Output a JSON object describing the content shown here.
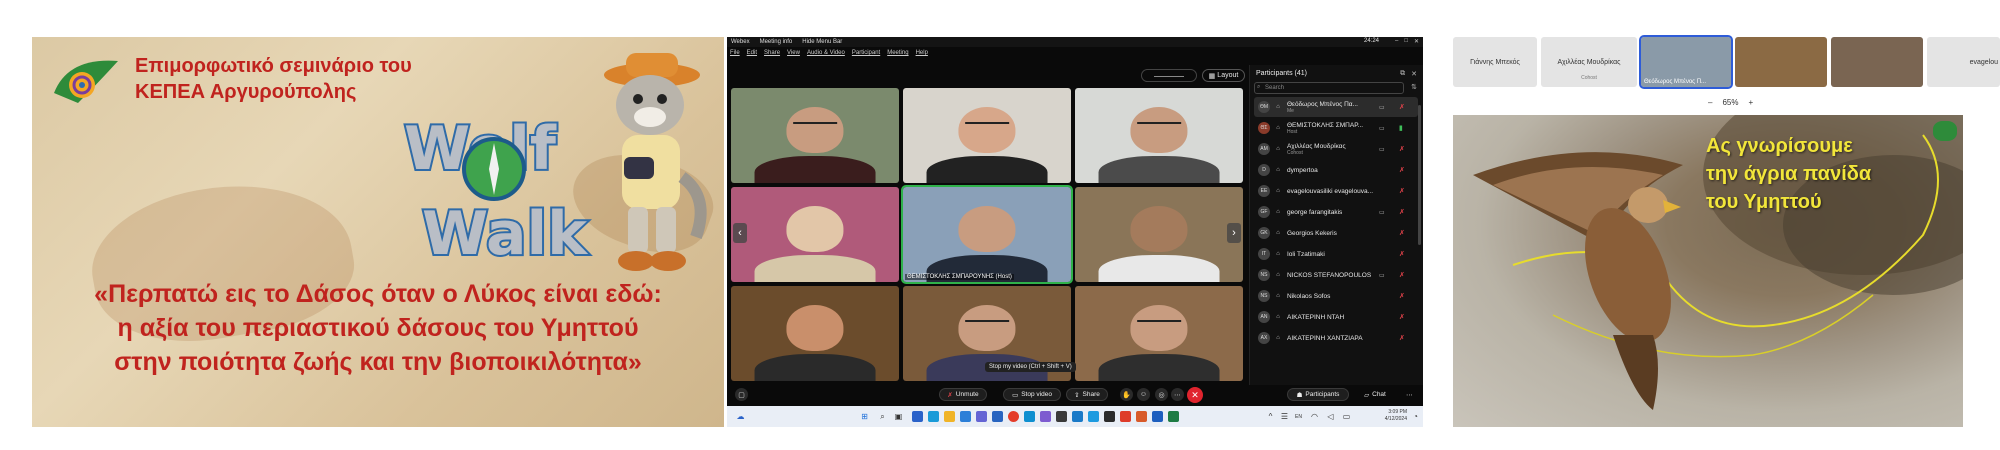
{
  "poster": {
    "seminar_line1": "Επιμορφωτικό σεμινάριο του",
    "seminar_line2": "ΚΕΠΕΑ Αργυρούπολης",
    "logo_word_top": "Wolf",
    "logo_word_bottom": "Walk",
    "headline_line1": "«Περπατώ εις το Δάσος όταν ο Λύκος είναι εδώ:",
    "headline_line2": "η αξία του περιαστικού δάσους του Υμηττού",
    "headline_line3": "στην ποιότητα ζωής και την βιοποικιλότητα»"
  },
  "webex": {
    "title_bar": {
      "app": "Webex",
      "meeting_info": "Meeting info",
      "hide_menu": "Hide Menu Bar",
      "time": "24:24"
    },
    "menu": [
      "File",
      "Edit",
      "Share",
      "View",
      "Audio & Video",
      "Participant",
      "Meeting",
      "Help"
    ],
    "layout_label": "Layout",
    "video_tiles": [
      {
        "name": ""
      },
      {
        "name": ""
      },
      {
        "name": ""
      },
      {
        "name": ""
      },
      {
        "name": "ΘΕΜΙΣΤΟΚΛΗΣ ΣΜΠΑΡΟΥΝΗΣ (Host)"
      },
      {
        "name": ""
      },
      {
        "name": ""
      },
      {
        "name": ""
      },
      {
        "name": ""
      }
    ],
    "tooltip": "Stop my video (Ctrl + Shift + V)",
    "participants": {
      "title": "Participants (41)",
      "search_placeholder": "Search",
      "list": [
        {
          "name": "Θεόδωρος Μπένος Πα...",
          "sub": "Me",
          "initials": "ΘΜ",
          "mic": "muted"
        },
        {
          "name": "ΘΕΜΙΣΤΟΚΛΗΣ ΣΜΠΑΡ...",
          "sub": "Host",
          "initials": "ΘΣ",
          "mic": "on"
        },
        {
          "name": "Αχιλλέας Μουδρίκας",
          "sub": "Cohost",
          "initials": "ΑΜ",
          "mic": "muted"
        },
        {
          "name": "dympertoa",
          "sub": "",
          "initials": "D",
          "mic": "muted"
        },
        {
          "name": "evagelouvasiliki evagelouva...",
          "sub": "",
          "initials": "EE",
          "mic": "muted"
        },
        {
          "name": "george farangitakis",
          "sub": "",
          "initials": "GF",
          "mic": "muted"
        },
        {
          "name": "Georgios Kekeris",
          "sub": "",
          "initials": "GK",
          "mic": "muted"
        },
        {
          "name": "Ioli Tzatimaki",
          "sub": "",
          "initials": "IT",
          "mic": "muted"
        },
        {
          "name": "NICKOS STEFANOPOULOS",
          "sub": "",
          "initials": "NS",
          "mic": "muted"
        },
        {
          "name": "Nikolaos Sofos",
          "sub": "",
          "initials": "NS",
          "mic": "muted"
        },
        {
          "name": "ΑΙΚΑΤΕΡΙΝΗ ΝΤΑΗ",
          "sub": "",
          "initials": "ΑΝ",
          "mic": "muted"
        },
        {
          "name": "ΑΙΚΑΤΕΡΙΝΗ ΧΑΝΤΖΙΑΡΑ",
          "sub": "",
          "initials": "ΑΧ",
          "mic": "muted"
        }
      ]
    },
    "controls": {
      "unmute": "Unmute",
      "stop_video": "Stop video",
      "share": "Share",
      "participants": "Participants",
      "chat": "Chat"
    },
    "taskbar": {
      "time": "3:09 PM",
      "date": "4/12/2024",
      "lang": "EN"
    }
  },
  "panel3": {
    "thumbnails": [
      {
        "name": "Γιάννης Μπεκός",
        "sub": ""
      },
      {
        "name": "Αχιλλέας Μουδρίκας",
        "sub": "Cohost"
      },
      {
        "name": "Θεόδωρος Μπένος Π...",
        "sub": ""
      },
      {
        "name": "",
        "sub": ""
      },
      {
        "name": "",
        "sub": ""
      },
      {
        "name": "evagelou",
        "sub": ""
      }
    ],
    "zoom_minus": "–",
    "zoom_level": "65%",
    "zoom_plus": "+",
    "caption_line1": "Ας γνωρίσουμε",
    "caption_line2": "την άγρια πανίδα",
    "caption_line3": "του Υμηττού"
  },
  "colors": {
    "poster_red": "#c0231e",
    "caption_yellow": "#f2e63a",
    "end_call": "#e0242e"
  }
}
